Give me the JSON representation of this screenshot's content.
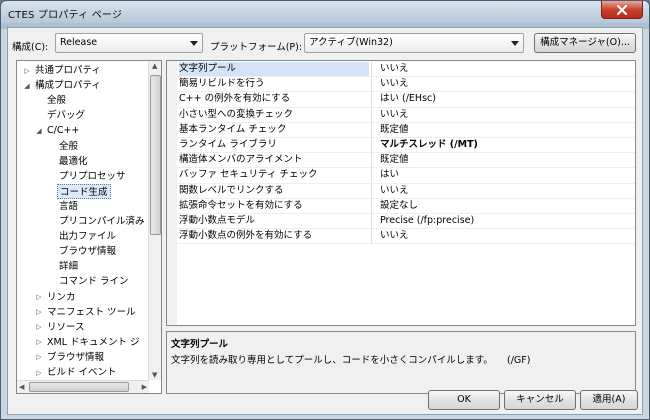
{
  "window": {
    "title": "CTES プロパティ ページ"
  },
  "toolbar": {
    "config_label": "構成(C):",
    "config_value": "Release",
    "platform_label": "プラットフォーム(P):",
    "platform_value": "アクティブ(Win32)",
    "config_manager_label": "構成マネージャ(O)..."
  },
  "tree": {
    "items": [
      {
        "label": "共通プロパティ",
        "level": 0,
        "expander": "closed"
      },
      {
        "label": "構成プロパティ",
        "level": 0,
        "expander": "open"
      },
      {
        "label": "全般",
        "level": 1,
        "expander": "none"
      },
      {
        "label": "デバッグ",
        "level": 1,
        "expander": "none"
      },
      {
        "label": "C/C++",
        "level": 1,
        "expander": "open"
      },
      {
        "label": "全般",
        "level": 2,
        "expander": "none"
      },
      {
        "label": "最適化",
        "level": 2,
        "expander": "none"
      },
      {
        "label": "プリプロセッサ",
        "level": 2,
        "expander": "none"
      },
      {
        "label": "コード生成",
        "level": 2,
        "expander": "none",
        "selected": true
      },
      {
        "label": "言語",
        "level": 2,
        "expander": "none"
      },
      {
        "label": "プリコンパイル済み",
        "level": 2,
        "expander": "none"
      },
      {
        "label": "出力ファイル",
        "level": 2,
        "expander": "none"
      },
      {
        "label": "ブラウザ情報",
        "level": 2,
        "expander": "none"
      },
      {
        "label": "詳細",
        "level": 2,
        "expander": "none"
      },
      {
        "label": "コマンド ライン",
        "level": 2,
        "expander": "none"
      },
      {
        "label": "リンカ",
        "level": 1,
        "expander": "closed"
      },
      {
        "label": "マニフェスト ツール",
        "level": 1,
        "expander": "closed"
      },
      {
        "label": "リソース",
        "level": 1,
        "expander": "closed"
      },
      {
        "label": "XML ドキュメント ジ",
        "level": 1,
        "expander": "closed"
      },
      {
        "label": "ブラウザ情報",
        "level": 1,
        "expander": "closed"
      },
      {
        "label": "ビルド イベント",
        "level": 1,
        "expander": "closed"
      }
    ]
  },
  "properties": [
    {
      "name": "文字列プール",
      "value": "いいえ",
      "selected": true
    },
    {
      "name": "簡易リビルドを行う",
      "value": "いいえ"
    },
    {
      "name": "C++ の例外を有効にする",
      "value": "はい (/EHsc)"
    },
    {
      "name": "小さい型への変換チェック",
      "value": "いいえ"
    },
    {
      "name": "基本ランタイム チェック",
      "value": "既定値"
    },
    {
      "name": "ランタイム ライブラリ",
      "value": "マルチスレッド (/MT)",
      "bold": true
    },
    {
      "name": "構造体メンバのアライメント",
      "value": "既定値"
    },
    {
      "name": "バッファ セキュリティ チェック",
      "value": "はい"
    },
    {
      "name": "関数レベルでリンクする",
      "value": "いいえ"
    },
    {
      "name": "拡張命令セットを有効にする",
      "value": "設定なし"
    },
    {
      "name": "浮動小数点モデル",
      "value": "Precise (/fp:precise)"
    },
    {
      "name": "浮動小数点の例外を有効にする",
      "value": "いいえ"
    }
  ],
  "description": {
    "title": "文字列プール",
    "text": "文字列を読み取り専用としてプールし、コードを小さくコンパイルします。　　(/GF)"
  },
  "buttons": {
    "ok": "OK",
    "cancel": "キャンセル",
    "apply": "適用(A)"
  }
}
